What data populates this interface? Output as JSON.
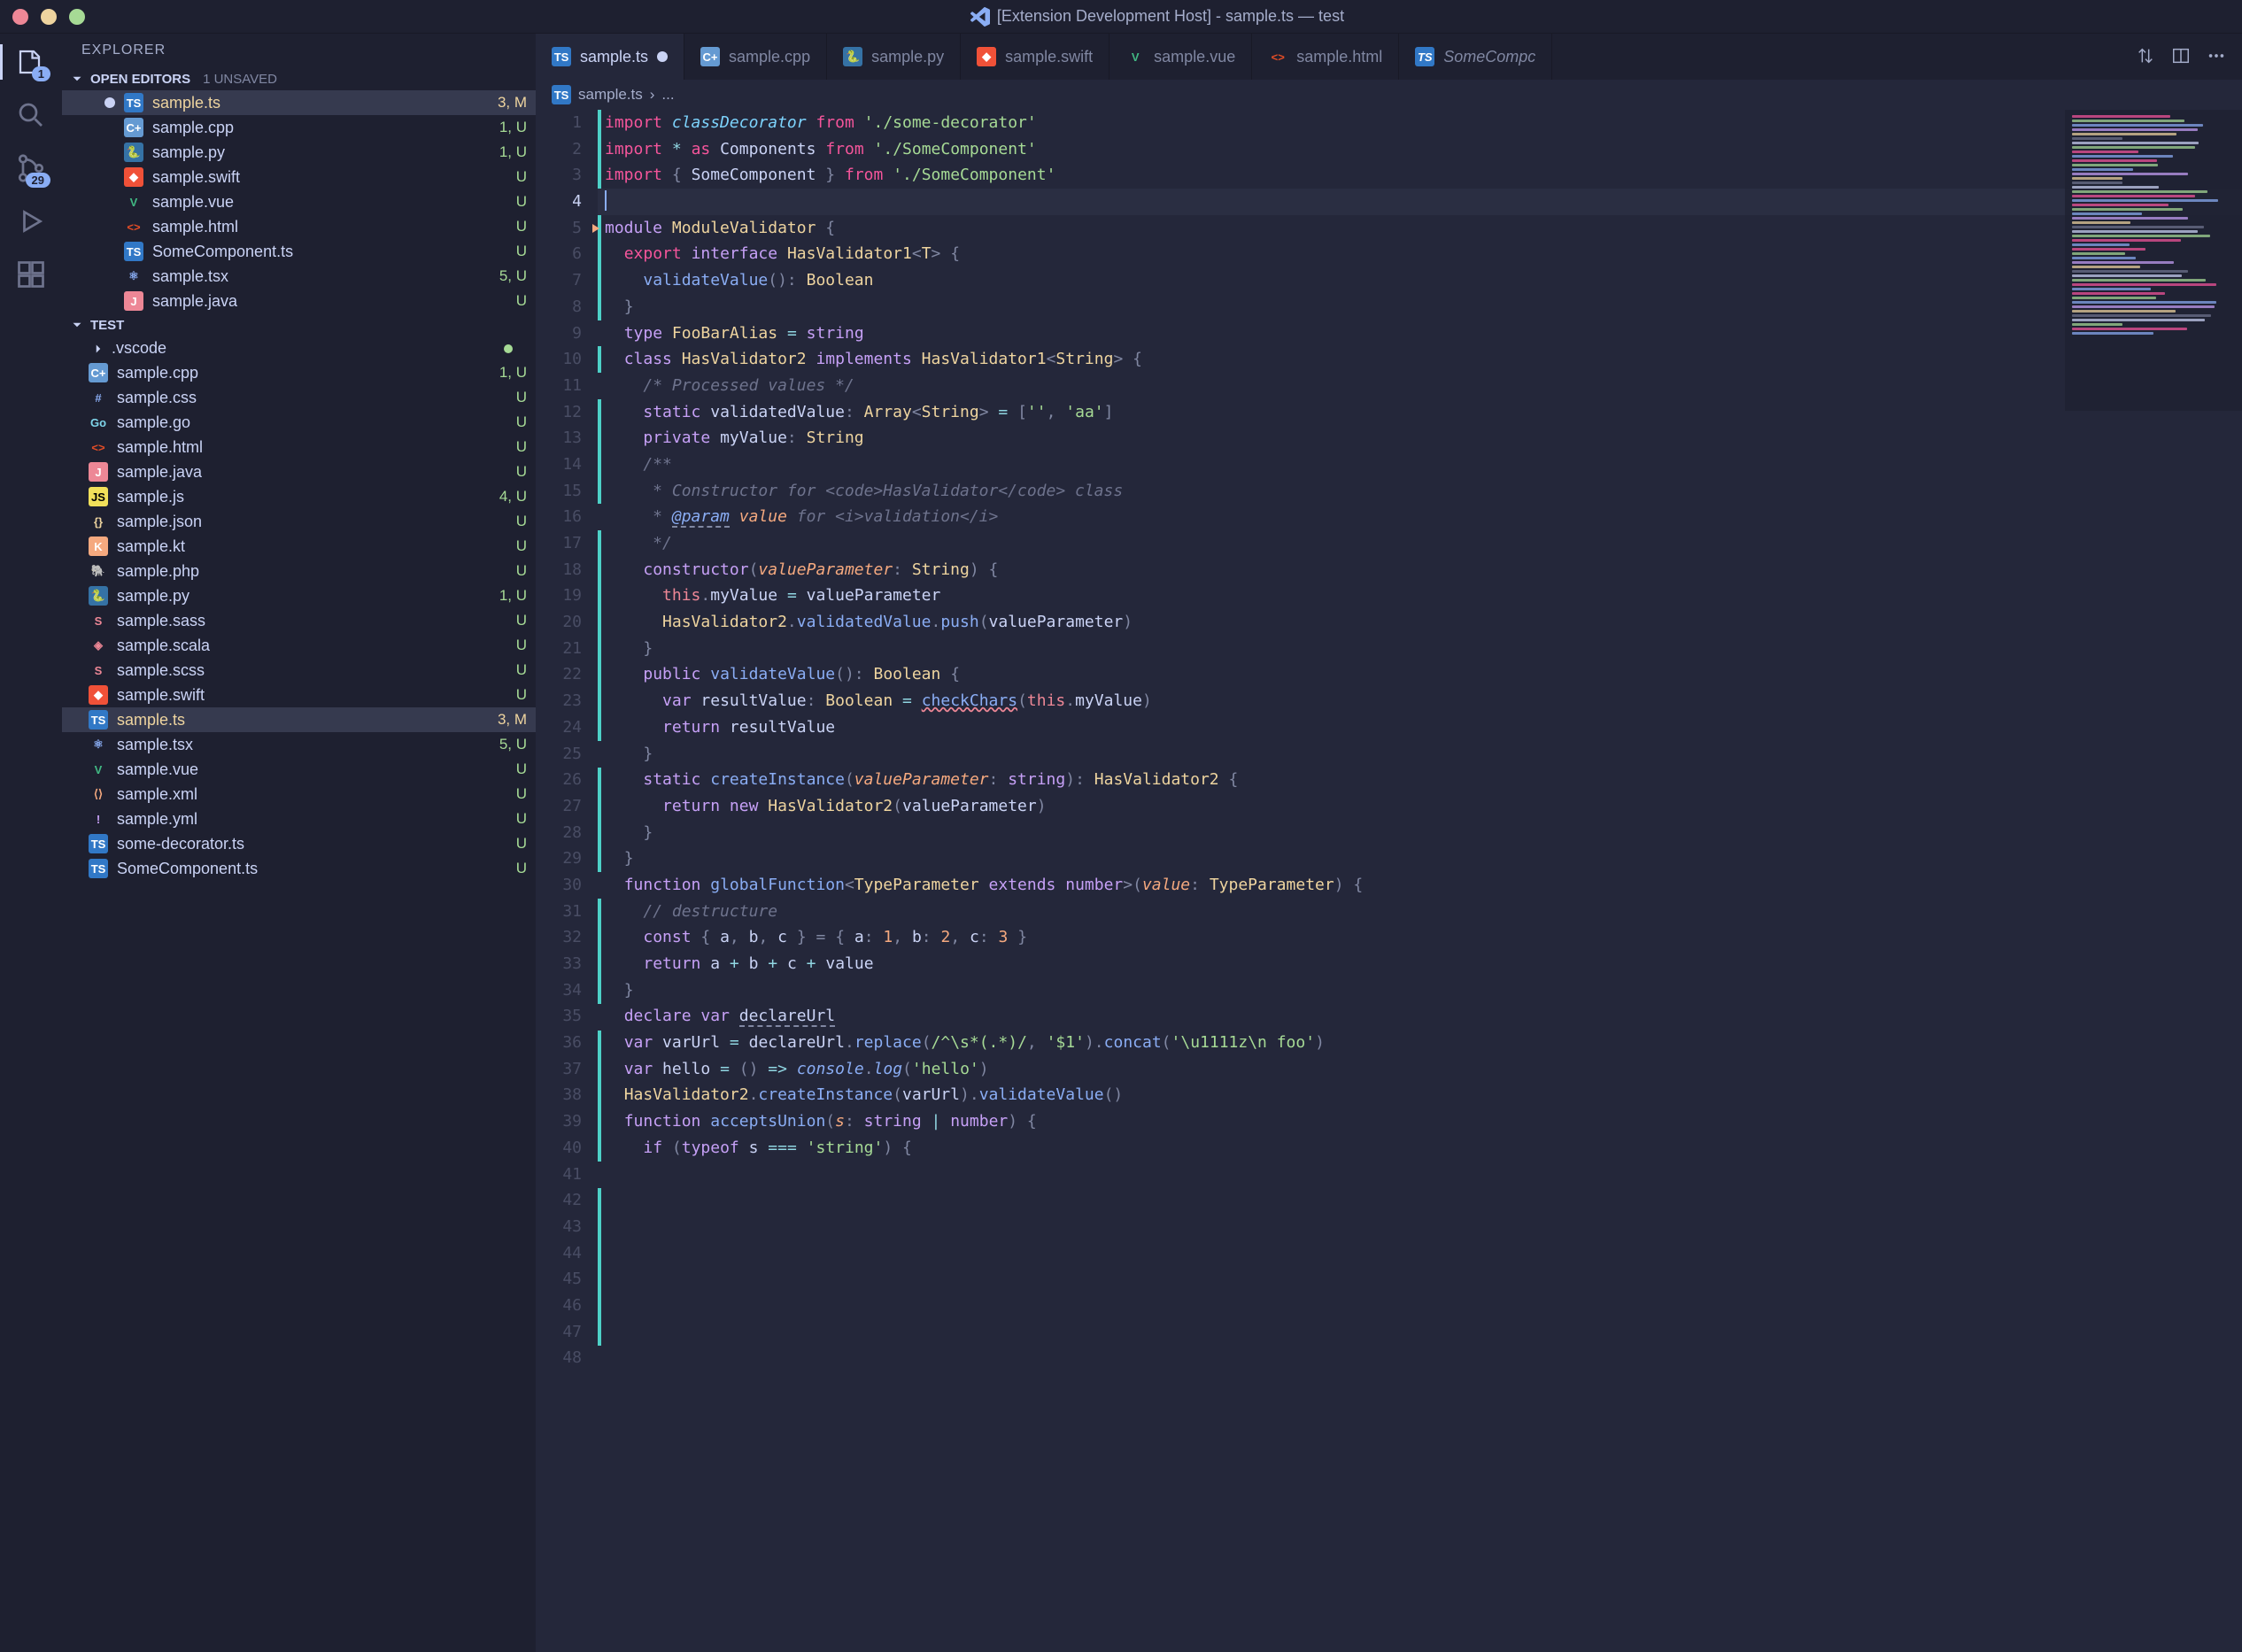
{
  "titlebar": {
    "title": "[Extension Development Host] - sample.ts — test"
  },
  "activity": {
    "explorer_badge": "1",
    "scm_badge": "29"
  },
  "sidebar": {
    "title": "EXPLORER",
    "open_editors_label": "OPEN EDITORS",
    "unsaved_label": "1 UNSAVED",
    "open_editors": [
      {
        "name": "sample.ts",
        "icon": "ts",
        "status": "3, M",
        "statusClass": "git-modified",
        "active": true,
        "dirty": true
      },
      {
        "name": "sample.cpp",
        "icon": "cpp",
        "status": "1, U",
        "statusClass": "git-U"
      },
      {
        "name": "sample.py",
        "icon": "py",
        "status": "1, U",
        "statusClass": "git-U"
      },
      {
        "name": "sample.swift",
        "icon": "swift",
        "status": "U",
        "statusClass": "git-U"
      },
      {
        "name": "sample.vue",
        "icon": "vue",
        "status": "U",
        "statusClass": "git-U"
      },
      {
        "name": "sample.html",
        "icon": "html",
        "status": "U",
        "statusClass": "git-U"
      },
      {
        "name": "SomeComponent.ts",
        "icon": "ts",
        "status": "U",
        "statusClass": "git-U"
      },
      {
        "name": "sample.tsx",
        "icon": "tsx",
        "status": "5, U",
        "statusClass": "git-U"
      },
      {
        "name": "sample.java",
        "icon": "java",
        "status": "U",
        "statusClass": "git-U"
      }
    ],
    "project_label": "TEST",
    "folder_vscode": ".vscode",
    "files": [
      {
        "name": "sample.cpp",
        "icon": "cpp",
        "status": "1, U",
        "statusClass": "git-U"
      },
      {
        "name": "sample.css",
        "icon": "css",
        "status": "U",
        "statusClass": "git-U"
      },
      {
        "name": "sample.go",
        "icon": "go",
        "status": "U",
        "statusClass": "git-U"
      },
      {
        "name": "sample.html",
        "icon": "html",
        "status": "U",
        "statusClass": "git-U"
      },
      {
        "name": "sample.java",
        "icon": "java",
        "status": "U",
        "statusClass": "git-U"
      },
      {
        "name": "sample.js",
        "icon": "js",
        "status": "4, U",
        "statusClass": "git-U"
      },
      {
        "name": "sample.json",
        "icon": "json",
        "status": "U",
        "statusClass": "git-U"
      },
      {
        "name": "sample.kt",
        "icon": "kt",
        "status": "U",
        "statusClass": "git-U"
      },
      {
        "name": "sample.php",
        "icon": "php",
        "status": "U",
        "statusClass": "git-U"
      },
      {
        "name": "sample.py",
        "icon": "py",
        "status": "1, U",
        "statusClass": "git-U"
      },
      {
        "name": "sample.sass",
        "icon": "sass",
        "status": "U",
        "statusClass": "git-U"
      },
      {
        "name": "sample.scala",
        "icon": "scala",
        "status": "U",
        "statusClass": "git-U"
      },
      {
        "name": "sample.scss",
        "icon": "sass",
        "status": "U",
        "statusClass": "git-U"
      },
      {
        "name": "sample.swift",
        "icon": "swift",
        "status": "U",
        "statusClass": "git-U"
      },
      {
        "name": "sample.ts",
        "icon": "ts",
        "status": "3, M",
        "statusClass": "git-modified",
        "active": true
      },
      {
        "name": "sample.tsx",
        "icon": "tsx",
        "status": "5, U",
        "statusClass": "git-U"
      },
      {
        "name": "sample.vue",
        "icon": "vue",
        "status": "U",
        "statusClass": "git-U"
      },
      {
        "name": "sample.xml",
        "icon": "xml",
        "status": "U",
        "statusClass": "git-U"
      },
      {
        "name": "sample.yml",
        "icon": "yml",
        "status": "U",
        "statusClass": "git-U"
      },
      {
        "name": "some-decorator.ts",
        "icon": "ts",
        "status": "U",
        "statusClass": "git-U"
      },
      {
        "name": "SomeComponent.ts",
        "icon": "ts",
        "status": "U",
        "statusClass": "git-U"
      }
    ]
  },
  "tabs": [
    {
      "name": "sample.ts",
      "icon": "ts",
      "active": true,
      "dirty": true
    },
    {
      "name": "sample.cpp",
      "icon": "cpp"
    },
    {
      "name": "sample.py",
      "icon": "py"
    },
    {
      "name": "sample.swift",
      "icon": "swift"
    },
    {
      "name": "sample.vue",
      "icon": "vue"
    },
    {
      "name": "sample.html",
      "icon": "html"
    },
    {
      "name": "SomeCompc",
      "icon": "ts",
      "italic": true
    }
  ],
  "breadcrumb": {
    "file": "sample.ts",
    "rest": "..."
  },
  "code_lines": 48,
  "cursor_line": 4
}
